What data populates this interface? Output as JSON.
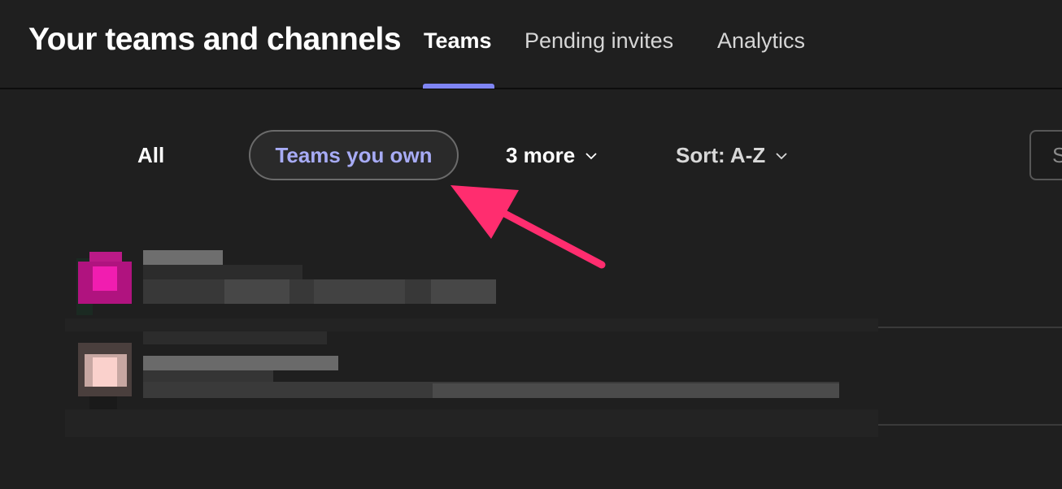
{
  "header": {
    "title": "Your teams and channels",
    "tabs": [
      {
        "label": "Teams",
        "active": true
      },
      {
        "label": "Pending invites",
        "active": false
      },
      {
        "label": "Analytics",
        "active": false
      }
    ]
  },
  "filters": {
    "all_label": "All",
    "owned_label": "Teams you own",
    "more_label": "3 more",
    "sort_label": "Sort: A-Z"
  },
  "search": {
    "placeholder": "S"
  },
  "colors": {
    "background": "#1f1f1f",
    "accent": "#7f85f5",
    "selected_filter_text": "#a7abf5",
    "annotation_arrow": "#ff2d6f",
    "team1_avatar": "#e0199f",
    "team2_avatar": "#f3c7c3"
  },
  "team_list": {
    "rows": [
      {
        "avatar": "pixelated-avatar-magenta",
        "text": "redacted"
      },
      {
        "avatar": "pixelated-avatar-pink",
        "text": "redacted"
      }
    ]
  }
}
